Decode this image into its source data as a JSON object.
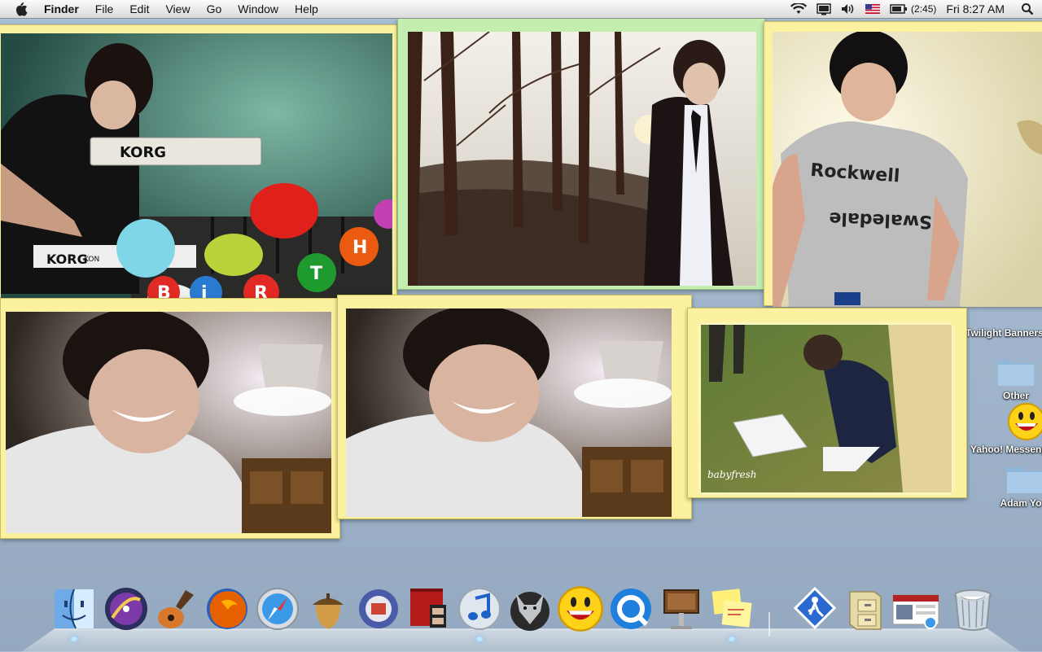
{
  "menubar": {
    "app": "Finder",
    "menus": [
      "File",
      "Edit",
      "View",
      "Go",
      "Window",
      "Help"
    ],
    "battery": "(2:45)",
    "clock": "Fri 8:27 AM"
  },
  "photos": {
    "keyboard_brand": "KORG",
    "keyboard_brand2": "KORG",
    "keyboard_brand3": "KON",
    "balloon_letters": [
      "B",
      "i",
      "R",
      "T",
      "H"
    ],
    "shirt_text_top": "Rockwell",
    "shirt_text_bottom": "Swaledale",
    "watermark": "babyfresh"
  },
  "desktop": {
    "items": [
      "Twilight Banners",
      "Other",
      "Yahoo! Messenger",
      "Adam Yo"
    ]
  },
  "dock": {
    "items": [
      "Finder",
      "Dashboard",
      "GarageBand",
      "Firefox",
      "Safari",
      "Acorn",
      "Mail Tool",
      "Front Row",
      "iTunes",
      "Camino",
      "Yahoo! Messenger",
      "QuickTime",
      "Keynote",
      "Stickies",
      "Applications",
      "Documents",
      "Screen",
      "Trash"
    ]
  }
}
